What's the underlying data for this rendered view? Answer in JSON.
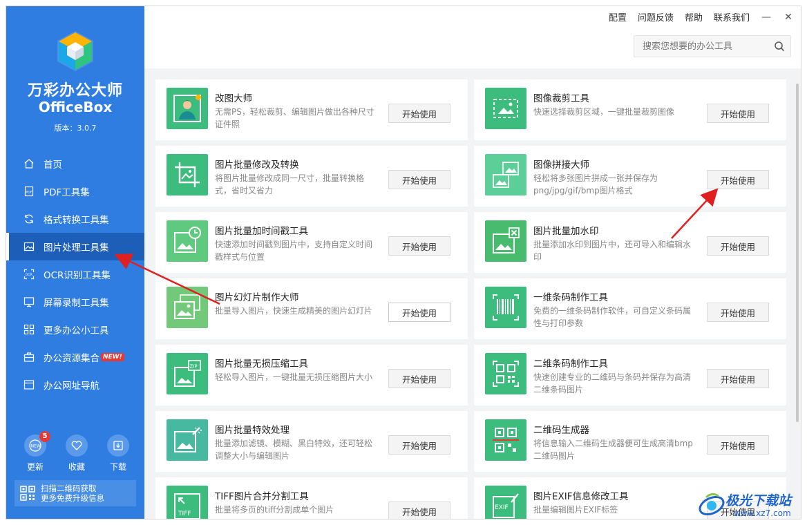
{
  "app": {
    "name_cn": "万彩办公大师",
    "name_en": "OfficeBox",
    "version": "版本：3.0.7"
  },
  "sidebar": {
    "items": [
      {
        "label": "首页",
        "icon": "home-icon"
      },
      {
        "label": "PDF工具集",
        "icon": "pdf-icon"
      },
      {
        "label": "格式转换工具集",
        "icon": "convert-icon"
      },
      {
        "label": "图片处理工具集",
        "icon": "image-icon",
        "active": true
      },
      {
        "label": "OCR识别工具集",
        "icon": "ocr-icon"
      },
      {
        "label": "屏幕录制工具集",
        "icon": "screen-icon"
      },
      {
        "label": "更多办公小工具",
        "icon": "grid-icon"
      },
      {
        "label": "办公资源集合",
        "icon": "briefcase-icon",
        "badge": "NEW!"
      },
      {
        "label": "办公网址导航",
        "icon": "browser-icon"
      }
    ],
    "actions": [
      {
        "label": "更新",
        "icon": "new-icon",
        "badge_count": "5"
      },
      {
        "label": "收藏",
        "icon": "heart-icon"
      },
      {
        "label": "下载",
        "icon": "download-icon"
      }
    ],
    "promo": {
      "line1": "扫描二维码获取",
      "line2": "更多免费升级信息"
    }
  },
  "topbar": {
    "links": [
      "配置",
      "问题反馈",
      "帮助",
      "联系我们"
    ],
    "minimize": "—",
    "close": "✕",
    "search_placeholder": "搜索您想要的办公工具"
  },
  "start_label": "开始使用",
  "tools": [
    {
      "title": "改图大师",
      "desc": "无需PS，轻松裁剪、编辑图片做出各种尺寸证件照",
      "icon": "portrait-icon"
    },
    {
      "title": "图像裁剪工具",
      "desc": "快速选择裁剪区域，一键批量裁剪图像",
      "icon": "crop-image-icon"
    },
    {
      "title": "图片批量修改及转换",
      "desc": "将图片批量修改成同一尺寸，批量转换格式，省时又省力",
      "icon": "resize-image-icon"
    },
    {
      "title": "图像拼接大师",
      "desc": "轻松将多张图片拼成一张并保存为png/jpg/gif/bmp图片格式",
      "icon": "stitch-image-icon"
    },
    {
      "title": "图片批量加时间戳工具",
      "desc": "快速添加时间戳到图片中，支持自定义时间戳样式与位置",
      "icon": "timestamp-image-icon"
    },
    {
      "title": "图片批量加水印",
      "desc": "批量添加水印到图片中，还可导入和编辑水印",
      "icon": "watermark-image-icon"
    },
    {
      "title": "图片幻灯片制作大师",
      "desc": "批量导入图片，快速生成精美的图片幻灯片",
      "icon": "slideshow-icon"
    },
    {
      "title": "一维条码制作工具",
      "desc": "免费的一维条码制作软件，可自定义条码属性与打印参数",
      "icon": "barcode-icon"
    },
    {
      "title": "图片批量无损压缩工具",
      "desc": "轻松导入图片，一键批量无损压缩图片大小",
      "icon": "zip-image-icon"
    },
    {
      "title": "二维条码制作工具",
      "desc": "快速创建专业的二维码与条码并保存为高清二维条码图片",
      "icon": "qrcode-maker-icon"
    },
    {
      "title": "图片批量特效处理",
      "desc": "批量添加滤镜、模糊、黑白特效，还可轻松调整大小与编辑图片",
      "icon": "effects-image-icon"
    },
    {
      "title": "二维码生成器",
      "desc": "将信息输入二维码生成器便可生成高清bmp二维码图片",
      "icon": "qrcode-generator-icon"
    },
    {
      "title": "TIFF图片合并分割工具",
      "desc": "批量将多页的tiff分割成单个图片",
      "icon": "tiff-icon"
    },
    {
      "title": "图片EXIF信息修改工具",
      "desc": "批量编辑图片EXIF标签",
      "icon": "exif-icon"
    }
  ],
  "watermark": {
    "text": "极光下载站",
    "url": "www.xz7.com"
  },
  "colors": {
    "sidebar": "#2f7de1",
    "sidebar_active": "#1d5fb8",
    "thumb_green": "#3dbd7d",
    "arrow_red": "#e02020"
  }
}
